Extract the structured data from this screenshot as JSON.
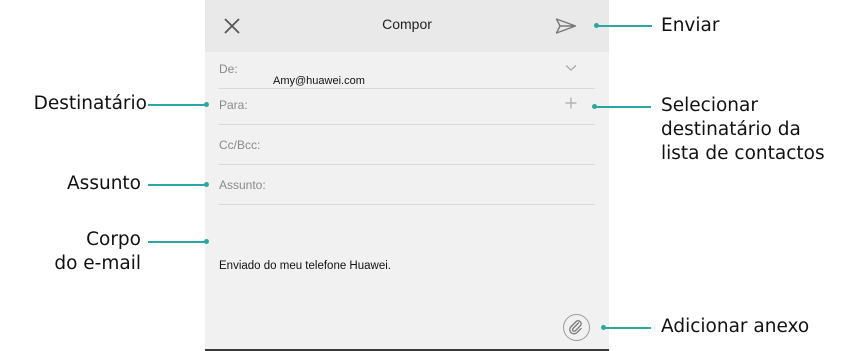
{
  "header": {
    "title": "Compor"
  },
  "fields": {
    "from_label": "De:",
    "from_value": "Amy@huawei.com",
    "to_label": "Para:",
    "cc_label": "Cc/Bcc:",
    "subject_label": "Assunto:"
  },
  "body": {
    "signature": "Enviado do meu telefone Huawei."
  },
  "annotations": {
    "send": "Enviar",
    "recipient": "Destinatário",
    "select_contact_line1": "Selecionar",
    "select_contact_line2": "destinatário da",
    "select_contact_line3": "lista de contactos",
    "subject": "Assunto",
    "body_line1": "Corpo",
    "body_line2": "do e-mail",
    "attach": "Adicionar anexo"
  },
  "icons": {
    "close": "close-icon",
    "send": "send-icon",
    "expand": "chevron-down-icon",
    "add_recipient": "plus-icon",
    "attach": "paperclip-icon"
  },
  "colors": {
    "accent": "#2aa8a0",
    "screen_bg": "#f1f1f1",
    "topbar_bg": "#e9e9e9"
  }
}
